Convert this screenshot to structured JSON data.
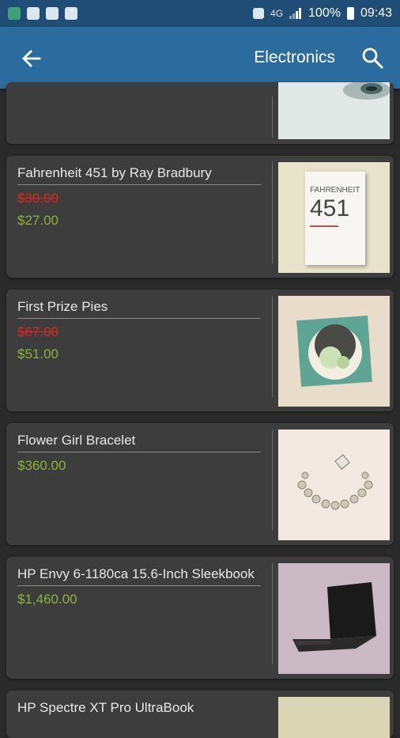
{
  "status_bar": {
    "network_label": "4G",
    "battery_percent": "100%",
    "time": "09:43"
  },
  "app_bar": {
    "title": "Electronics",
    "back_icon": "arrow-back-icon",
    "search_icon": "search-icon"
  },
  "products": [
    {
      "name": "Fahrenheit 451 by Ray Bradbury",
      "old_price": "$30.00",
      "price": "$27.00",
      "book_cover_text": "FAHRENHEIT",
      "book_cover_number": "451"
    },
    {
      "name": "First Prize Pies",
      "old_price": "$67.00",
      "price": "$51.00"
    },
    {
      "name": "Flower Girl Bracelet",
      "price": "$360.00"
    },
    {
      "name": "HP Envy 6-1180ca 15.6-Inch Sleekbook",
      "price": "$1,460.00"
    },
    {
      "name": "HP Spectre XT Pro UltraBook"
    }
  ],
  "colors": {
    "status_bar": "#1f4d75",
    "app_bar": "#2b6b9e",
    "background": "#2a2a2a",
    "card": "#3d3d3d",
    "price": "#8bb33a",
    "old_price": "#d9261c"
  }
}
